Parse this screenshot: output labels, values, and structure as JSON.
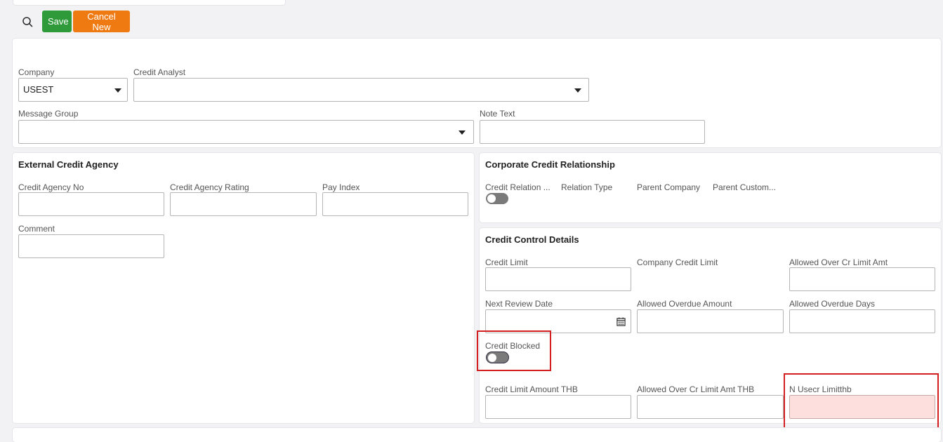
{
  "toolbar": {
    "save_label": "Save",
    "cancel_label": "Cancel New"
  },
  "header": {
    "company_label": "Company",
    "company_value": "USEST",
    "credit_analyst_label": "Credit Analyst",
    "message_group_label": "Message Group",
    "note_text_label": "Note Text"
  },
  "external_agency": {
    "title": "External Credit Agency",
    "credit_agency_no_label": "Credit Agency No",
    "credit_agency_rating_label": "Credit Agency Rating",
    "pay_index_label": "Pay Index",
    "comment_label": "Comment"
  },
  "corporate": {
    "title": "Corporate Credit Relationship",
    "credit_relation_label": "Credit Relation ...",
    "relation_type_label": "Relation Type",
    "parent_company_label": "Parent Company",
    "parent_customer_label": "Parent Custom..."
  },
  "credit_control": {
    "title": "Credit Control Details",
    "credit_limit_label": "Credit Limit",
    "company_credit_limit_label": "Company Credit Limit",
    "allowed_over_label": "Allowed Over Cr Limit Amt",
    "next_review_label": "Next Review Date",
    "allowed_overdue_amount_label": "Allowed Overdue Amount",
    "allowed_overdue_days_label": "Allowed Overdue Days",
    "credit_blocked_label": "Credit Blocked",
    "credit_limit_thb_label": "Credit Limit Amount THB",
    "allowed_over_thb_label": "Allowed Over Cr Limit Amt THB",
    "n_usecr_label": "N Usecr Limitthb"
  },
  "colors": {
    "save": "#2e9a3a",
    "cancel": "#f07a12",
    "highlight": "#d21f1f",
    "invalid_fill": "#fde0dd"
  },
  "icons": {
    "search": "search-icon",
    "calendar": "calendar-icon",
    "dropdown": "chevron-down-icon"
  }
}
